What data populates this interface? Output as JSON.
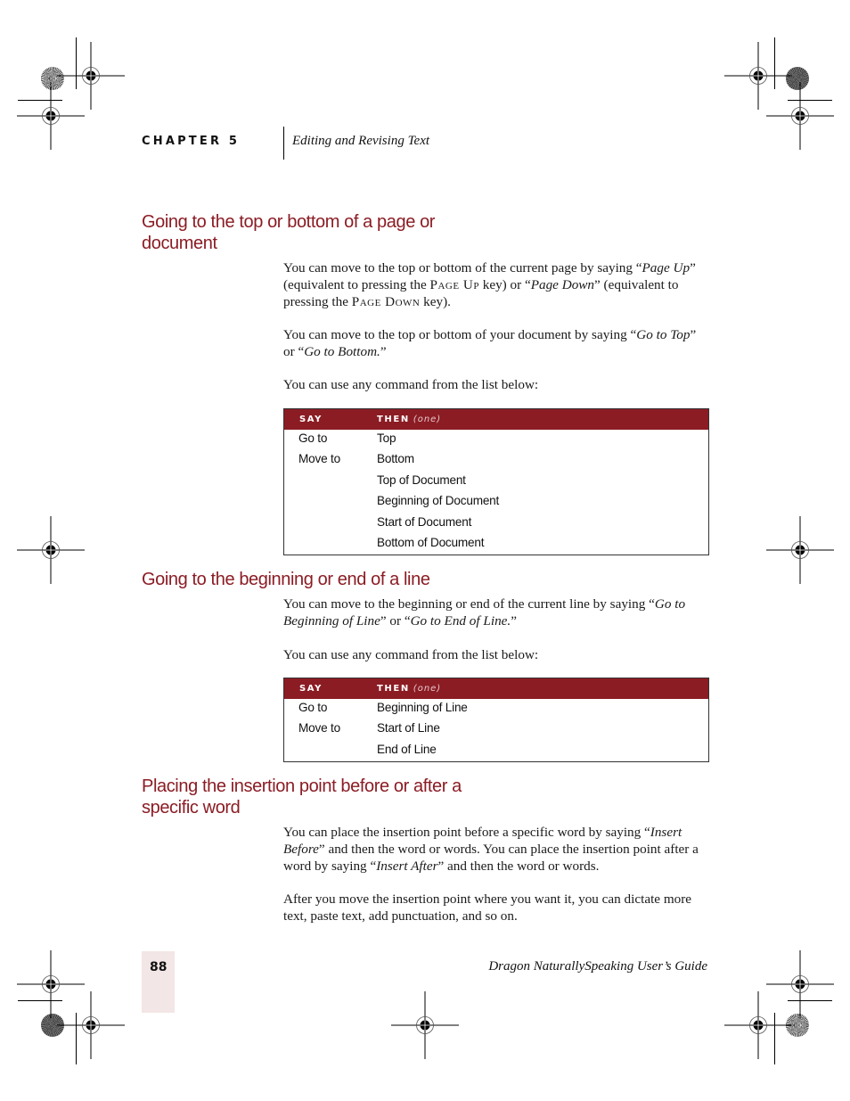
{
  "header": {
    "chapter_label": "CHAPTER 5",
    "chapter_title": "Editing and Revising Text"
  },
  "sections": [
    {
      "heading_line1": "Going to the top or bottom of a page or",
      "heading_line2": "document",
      "paragraphs": [
        {
          "p1": "You can move to the top or bottom of the current page by saying “",
          "i1": "Page Up",
          "p2": "” (equivalent to pressing the ",
          "k1": "Page Up",
          "p3": " key) or “",
          "i2": "Page Down",
          "p4": "” (equivalent to pressing the ",
          "k2": "Page Down",
          "p5": " key)."
        },
        {
          "p1": "You can move to the top or bottom of your document by saying “",
          "i1": "Go to Top",
          "p2": "” or “",
          "i2": "Go to Bottom.",
          "p3": "”"
        },
        {
          "text": "You can use any command from the list below:"
        }
      ],
      "table": {
        "col_say": "SAY",
        "col_then": "THEN",
        "col_then_note": "(one)",
        "say": [
          "Go to",
          "Move to",
          "",
          "",
          "",
          ""
        ],
        "then": [
          "Top",
          "Bottom",
          "Top of Document",
          "Beginning of Document",
          "Start of Document",
          "Bottom of Document"
        ]
      }
    },
    {
      "heading_line1": "Going to the beginning or end of a line",
      "paragraphs": [
        {
          "p1": "You can move to the beginning or end of the current line by saying “",
          "i1": "Go to Beginning of Line",
          "p2": "” or “",
          "i2": "Go to End of Line.",
          "p3": "”"
        },
        {
          "text": "You can use any command from the list below:"
        }
      ],
      "table": {
        "col_say": "SAY",
        "col_then": "THEN",
        "col_then_note": "(one)",
        "say": [
          "Go to",
          "Move to",
          ""
        ],
        "then": [
          "Beginning of Line",
          "Start of Line",
          "End of Line"
        ]
      }
    },
    {
      "heading_line1": "Placing the insertion point before or after a",
      "heading_line2": "specific word",
      "paragraphs": [
        {
          "p1": "You can place the insertion point before a specific word by saying “",
          "i1": "Insert Before",
          "p2": "” and then the word or words. You can place the insertion point after a word by saying “",
          "i2": "Insert After",
          "p3": "” and then the word or words."
        },
        {
          "text": "After you move the insertion point where you want it, you can dictate more text, paste text, add punctuation, and so on."
        }
      ]
    }
  ],
  "footer": {
    "page_number": "88",
    "book_title": "Dragon NaturallySpeaking User’s Guide"
  },
  "colors": {
    "accent": "#8b1c24",
    "page_tab": "#f3e6e6"
  }
}
